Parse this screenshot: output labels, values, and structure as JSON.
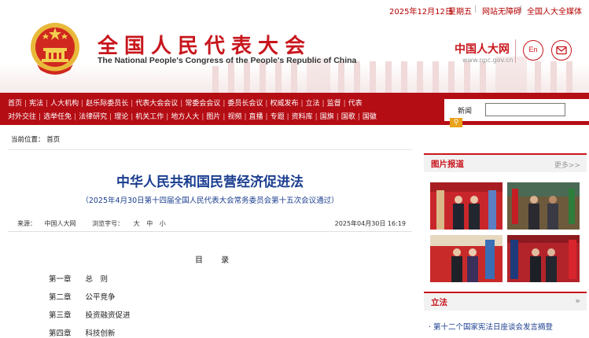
{
  "topbar": {
    "date": "2025年12月12日",
    "weekday": "星期五",
    "accessibility_link": "网站无障碍",
    "media_matrix_link": "全国人大全媒体"
  },
  "header": {
    "title_cn": "全国人民代表大会",
    "title_en": "The National People's Congress of the People's Republic of China",
    "logo_text": "中国人大网",
    "logo_url": "www.npc.gov.cn",
    "lang_button": "En",
    "mail_icon": "mail-icon"
  },
  "nav": {
    "row1": [
      "首页",
      "宪法",
      "人大机构",
      "赵乐际委员长",
      "代表大会会议",
      "常委会会议",
      "委员长会议",
      "权威发布",
      "立法",
      "监督",
      "代表"
    ],
    "row2": [
      "对外交往",
      "选举任免",
      "法律研究",
      "理论",
      "机关工作",
      "地方人大",
      "图片",
      "视频",
      "直播",
      "专题",
      "资料库",
      "国旗",
      "国歌",
      "国徽"
    ]
  },
  "search": {
    "label": "新闻",
    "placeholder": "",
    "button_icon": "search-icon"
  },
  "breadcrumb": {
    "prefix": "当前位置：",
    "home": "首页"
  },
  "article": {
    "title": "中华人民共和国民营经济促进法",
    "subtitle": "（2025年4月30日第十四届全国人民代表大会常务委员会第十五次会议通过）",
    "source_label": "来源：",
    "source": "中国人大网",
    "font_label": "浏览字号：",
    "font_sizes": [
      "大",
      "中",
      "小"
    ],
    "datetime": "2025年04月30日  16:19",
    "toc_heading": "目 录",
    "chapters": [
      {
        "no": "第一章",
        "name": "总　则"
      },
      {
        "no": "第二章",
        "name": "公平竞争"
      },
      {
        "no": "第三章",
        "name": "投资融资促进"
      },
      {
        "no": "第四章",
        "name": "科技创新"
      }
    ]
  },
  "sidebar": {
    "photo_section": {
      "title": "图片报道",
      "more": "更多>>"
    },
    "law_section": {
      "title": "立法",
      "more": "»"
    },
    "law_items": [
      "第十二个国家宪法日座谈会发言摘登"
    ]
  }
}
